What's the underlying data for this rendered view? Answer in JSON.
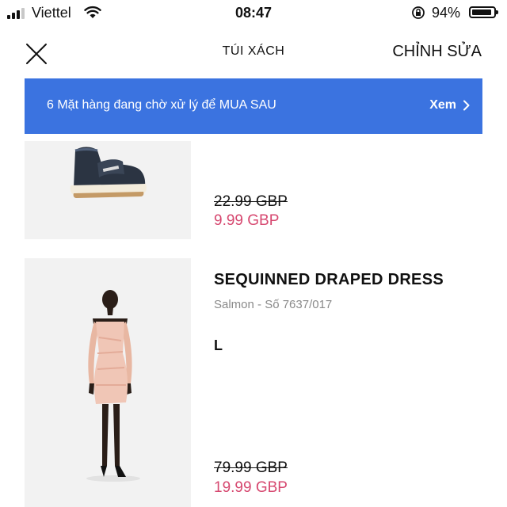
{
  "status_bar": {
    "carrier": "Viettel",
    "time": "08:47",
    "battery_percent": "94%",
    "battery_level": 0.94,
    "signal_bars_filled": 3,
    "signal_bars_total": 4
  },
  "header": {
    "title": "TÚI XÁCH",
    "edit_label": "CHỈNH SỬA",
    "close_icon": "close-icon"
  },
  "banner": {
    "text": "6 Mặt hàng đang chờ xử lý để MUA SAU",
    "link_label": "Xem",
    "background": "#3b73e0"
  },
  "products": [
    {
      "image": "sneaker-image",
      "price_original": "22.99 GBP",
      "price_sale": "9.99 GBP"
    },
    {
      "image": "dress-model-image",
      "name": "SEQUINNED DRAPED DRESS",
      "subtitle": "Salmon - Số 7637/017",
      "size": "L",
      "price_original": "79.99 GBP",
      "price_sale": "19.99 GBP"
    }
  ],
  "colors": {
    "sale_price": "#d6476f",
    "accent": "#3b73e0"
  }
}
